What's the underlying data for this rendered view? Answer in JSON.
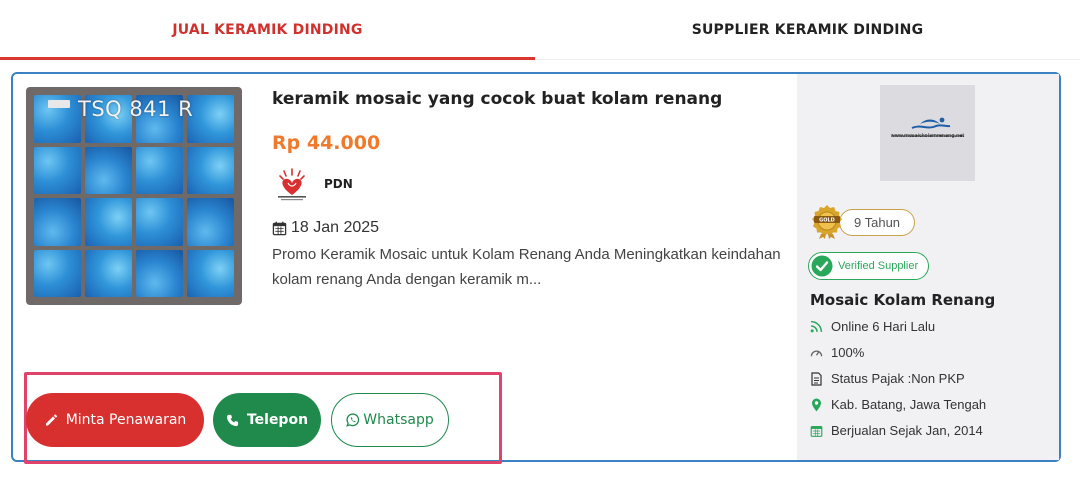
{
  "tabs": {
    "sell_label": "JUAL KERAMIK DINDING",
    "supplier_label": "SUPPLIER KERAMIK DINDING"
  },
  "product": {
    "image_code": "TSQ 841 R",
    "title": "keramik mosaic yang cocok buat kolam renang",
    "price": "Rp 44.000",
    "pdn_label": "PDN",
    "date": "18 Jan 2025",
    "description": "Promo Keramik Mosaic untuk Kolam Renang Anda Meningkatkan keindahan kolam renang Anda dengan keramik m..."
  },
  "actions": {
    "offer_label": "Minta Penawaran",
    "call_label": "Telepon",
    "whatsapp_label": "Whatsapp"
  },
  "seller": {
    "logo_text": "www.mosaickolamrenang.net",
    "years_label": "9 Tahun",
    "verified_label": "Verified Supplier",
    "name": "Mosaic Kolam Renang",
    "online": "Online 6 Hari Lalu",
    "response_rate": "100%",
    "tax_status": "Status Pajak :Non PKP",
    "location": "Kab. Batang, Jawa Tengah",
    "since": "Berjualan Sejak Jan, 2014"
  },
  "colors": {
    "accent_red": "#d82f2f",
    "price_orange": "#f07a2c",
    "green": "#1f8a4c",
    "card_border": "#3b82c4"
  }
}
